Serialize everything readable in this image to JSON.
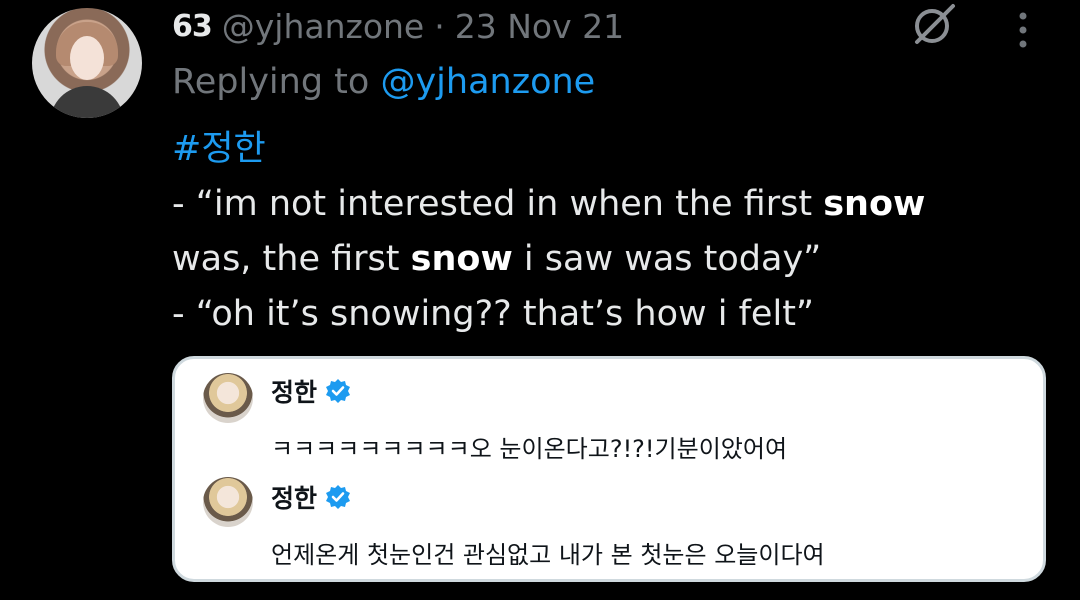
{
  "tweet": {
    "header_badge": "63",
    "handle": "@yjhanzone",
    "separator": "·",
    "date": "23 Nov 21",
    "replying_prefix": "Replying to ",
    "replying_handle": "@yjhanzone",
    "hashtag": "#정한",
    "line1_a": "- “im not interested in when the first ",
    "line1_bold": "snow",
    "line2_a": "was, the first ",
    "line2_bold": "snow",
    "line2_b": " i saw was today”",
    "line3": "- “oh it’s snowing?? that’s how i felt”"
  },
  "quote": {
    "items": [
      {
        "name": "정한",
        "text": "ㅋㅋㅋㅋㅋㅋㅋㅋㅋ오 눈이온다고?!?!기분이았어여"
      },
      {
        "name": "정한",
        "text": "언제온게 첫눈인건 관심없고 내가 본 첫눈은 오늘이다여"
      }
    ]
  },
  "colors": {
    "background": "#000000",
    "link": "#1d9bf0",
    "muted": "#71767b",
    "verified": "#1d9bf0",
    "quote_bg": "#ffffff"
  },
  "icons": [
    "grok-icon",
    "more-icon",
    "verified-icon"
  ]
}
